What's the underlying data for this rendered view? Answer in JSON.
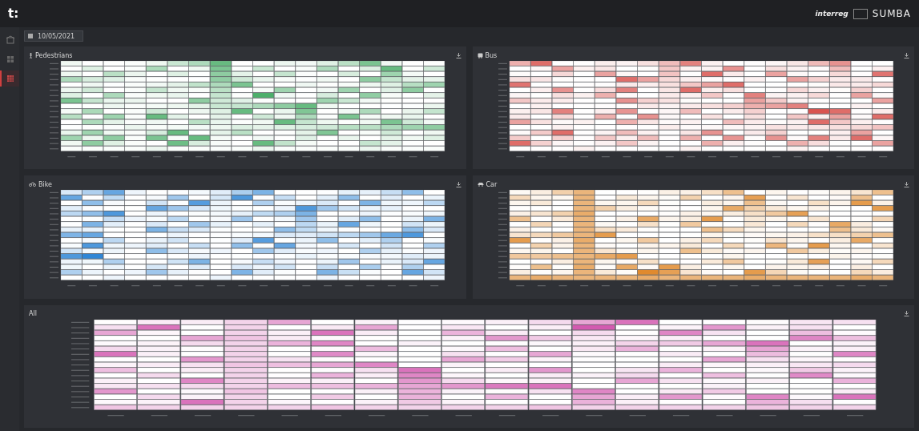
{
  "app_logo": "t:",
  "partner_logos": {
    "interreg": "interreg",
    "project": "SUMBA"
  },
  "sidebar": {
    "items": [
      {
        "kind": "home",
        "selected": false
      },
      {
        "kind": "grid",
        "selected": false
      },
      {
        "kind": "matrix",
        "selected": true
      }
    ]
  },
  "date_field": {
    "value": "10/05/2021"
  },
  "panels": [
    {
      "title": "Pedestrians",
      "kind": "pedestrian"
    },
    {
      "title": "Bus",
      "kind": "bus"
    },
    {
      "title": "Bike",
      "kind": "bike"
    },
    {
      "title": "Car",
      "kind": "car"
    },
    {
      "title": "All",
      "kind": "all"
    }
  ]
}
